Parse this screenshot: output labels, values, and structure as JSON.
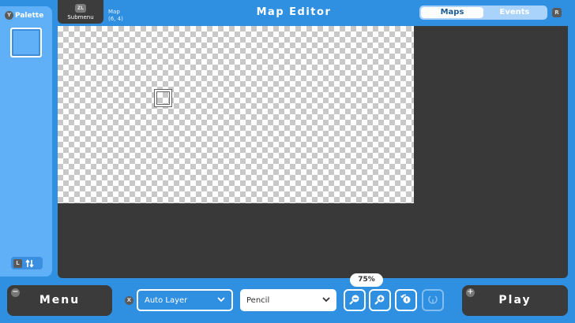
{
  "header": {
    "submenu_badge": "ZL",
    "submenu_label": "Submenu",
    "map_label": "Map",
    "map_coords": "(6, 4)",
    "title": "Map Editor",
    "tabs": [
      {
        "label": "Maps",
        "active": true
      },
      {
        "label": "Events",
        "active": false
      }
    ],
    "right_badge": "R"
  },
  "palette": {
    "badge": "Y",
    "title": "Palette",
    "swap_badge": "L",
    "swap_icon": "swap-arrows-icon",
    "swatch_color": "#5fb0f7"
  },
  "bottom": {
    "menu_label": "Menu",
    "menu_icon": "minus-icon",
    "play_label": "Play",
    "play_icon": "plus-icon",
    "layer_badge": "X",
    "layer_select": "Auto Layer",
    "tool_select": "Pencil",
    "zoom": "75%",
    "tools": [
      "zoom-out-icon",
      "zoom-in-icon",
      "zoom-reset-icon",
      "zoom-fit-icon"
    ]
  },
  "colors": {
    "background": "#2f8fe0",
    "panel": "#5fb0f7",
    "canvas": "#393939",
    "button_dark": "#3b3b3b"
  }
}
